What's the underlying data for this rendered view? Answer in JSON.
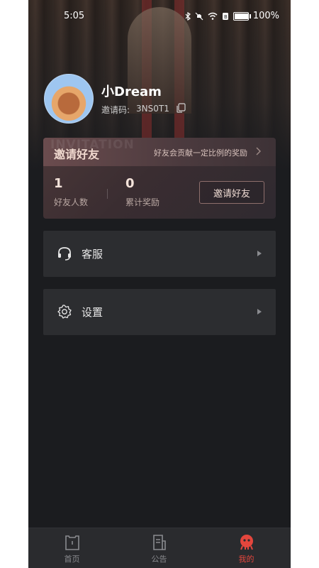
{
  "status_bar": {
    "time": "5:05",
    "battery": "100%",
    "battery_level": 1.0
  },
  "profile": {
    "username": "小Dream",
    "invite_code_label": "邀请码:",
    "invite_code": "3NS0T1"
  },
  "invite_card": {
    "watermark": "INVITATION",
    "title": "邀请好友",
    "hint": "好友会贡献一定比例的奖励",
    "stats": [
      {
        "value": "1",
        "label": "好友人数"
      },
      {
        "value": "0",
        "label": "累计奖励"
      }
    ],
    "button_label": "邀请好友"
  },
  "menu": [
    {
      "label": "客服",
      "icon": "headset-icon"
    },
    {
      "label": "设置",
      "icon": "gear-icon"
    }
  ],
  "tabbar": {
    "items": [
      {
        "label": "首页",
        "icon": "home-icon",
        "active": false
      },
      {
        "label": "公告",
        "icon": "notice-icon",
        "active": false
      },
      {
        "label": "我的",
        "icon": "mine-icon",
        "active": true
      }
    ]
  },
  "colors": {
    "background": "#1b1c1f",
    "card": "#2c2d30",
    "accent": "#e3463d",
    "invite_title": "#f0d9cf"
  }
}
